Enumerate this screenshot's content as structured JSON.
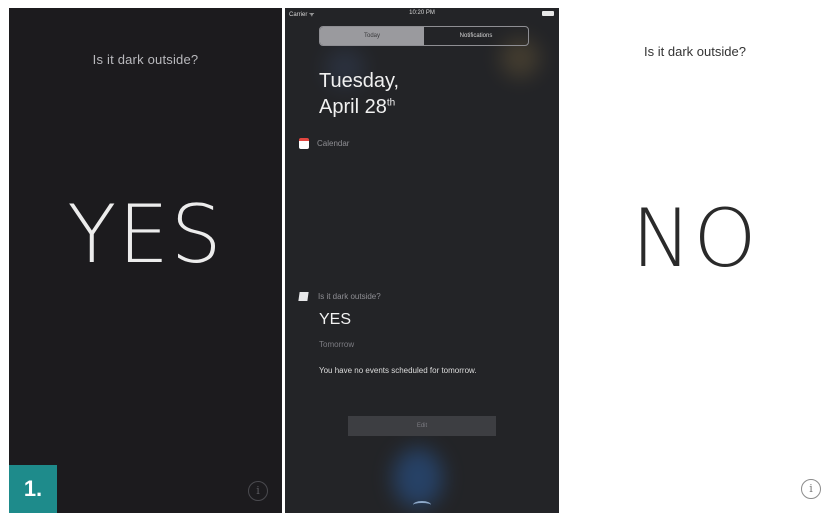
{
  "figure_number": "1.",
  "dark_app": {
    "question": "Is it dark outside?",
    "answer": "YES",
    "info_glyph": "i"
  },
  "notification_center": {
    "status": {
      "carrier": "Carrier ᯤ",
      "time": "10:20 PM"
    },
    "tabs": [
      {
        "label": "Today",
        "selected": true
      },
      {
        "label": "Notifications",
        "selected": false
      }
    ],
    "date_weekday": "Tuesday,",
    "date_day": "April 28",
    "date_suffix": "th",
    "calendar_label": "Calendar",
    "widget": {
      "title": "Is it dark outside?",
      "answer": "YES",
      "tomorrow_label": "Tomorrow",
      "events_text": "You have no events scheduled for tomorrow."
    },
    "edit_label": "Edit"
  },
  "light_app": {
    "question": "Is it dark outside?",
    "answer": "NO",
    "info_glyph": "i"
  },
  "colors": {
    "dark_bg": "#1c1b1e",
    "nc_bg": "#232427",
    "badge": "#1e8b8b",
    "calendar_red": "#e24640"
  }
}
